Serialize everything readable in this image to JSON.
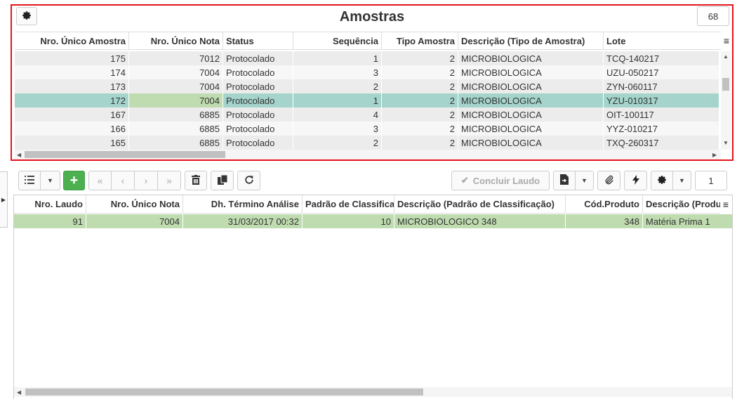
{
  "samples_panel": {
    "title": "Amostras",
    "record_count": "68",
    "columns": [
      "Nro. Único Amostra",
      "Nro. Único Nota",
      "Status",
      "Sequência",
      "Tipo Amostra",
      "Descrição (Tipo de Amostra)",
      "Lote"
    ],
    "rows": [
      [
        "175",
        "7012",
        "Protocolado",
        "1",
        "2",
        "MICROBIOLOGICA",
        "TCQ-140217"
      ],
      [
        "174",
        "7004",
        "Protocolado",
        "3",
        "2",
        "MICROBIOLOGICA",
        "UZU-050217"
      ],
      [
        "173",
        "7004",
        "Protocolado",
        "2",
        "2",
        "MICROBIOLOGICA",
        "ZYN-060117"
      ],
      [
        "172",
        "7004",
        "Protocolado",
        "1",
        "2",
        "MICROBIOLOGICA",
        "YZU-010317"
      ],
      [
        "167",
        "6885",
        "Protocolado",
        "4",
        "2",
        "MICROBIOLOGICA",
        "OIT-100117"
      ],
      [
        "166",
        "6885",
        "Protocolado",
        "3",
        "2",
        "MICROBIOLOGICA",
        "YYZ-010217"
      ],
      [
        "165",
        "6885",
        "Protocolado",
        "2",
        "2",
        "MICROBIOLOGICA",
        "TXQ-260317"
      ]
    ],
    "selected_row": 3
  },
  "toolbar": {
    "conclude_label": "Concluir Laudo",
    "page_number": "1",
    "icons": [
      "list-icon",
      "caret-down-icon",
      "plus-icon",
      "first-page-icon",
      "previous-icon",
      "next-icon",
      "last-page-icon",
      "trash-icon",
      "copy-icon",
      "refresh-icon",
      "check-icon",
      "file-export-icon",
      "paperclip-icon",
      "bolt-icon",
      "gear-icon"
    ]
  },
  "reports_panel": {
    "columns": [
      "Nro. Laudo",
      "Nro. Único Nota",
      "Dh. Término Análise",
      "Padrão de Classificação",
      "Descrição (Padrão de Classificação)",
      "Cód.Produto",
      "Descrição (Produto)"
    ],
    "rows": [
      [
        "91",
        "7004",
        "31/03/2017 00:32",
        "10",
        "MICROBIOLOGICO 348",
        "348",
        "Matéria Prima 1"
      ]
    ]
  },
  "colors": {
    "panel_border": "#e3141c",
    "selected_row": "#a4d4cb",
    "highlight_cell": "#bfdcb0",
    "add_button": "#4caf50"
  }
}
